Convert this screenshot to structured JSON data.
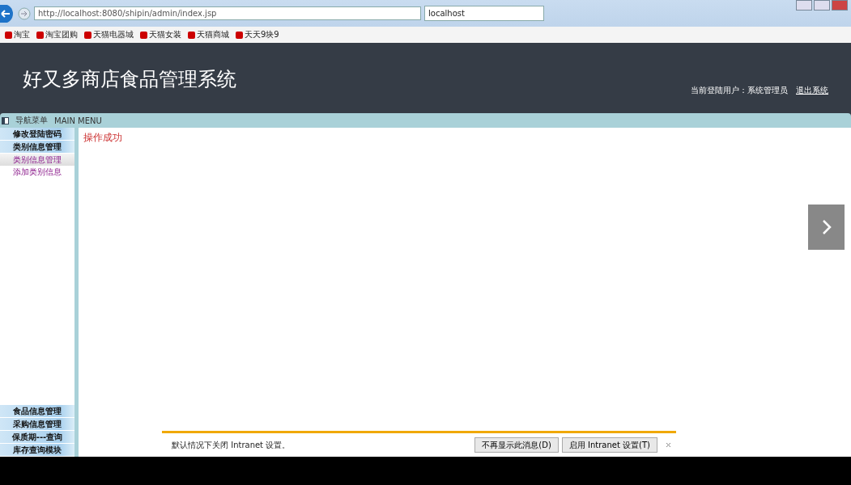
{
  "browser": {
    "address": "http://localhost:8080/shipin/admin/index.jsp",
    "tab": "localhost",
    "bookmarks": [
      "淘宝",
      "淘宝团购",
      "天猫电器城",
      "天猫女装",
      "天猫商城",
      "天天9块9"
    ]
  },
  "header": {
    "title": "好又多商店食品管理系统",
    "user_label": "当前登陆用户：系统管理员",
    "logout": "退出系统"
  },
  "menu": {
    "title": "导航菜单",
    "subtitle": "MAIN MENU",
    "top_items": [
      {
        "label": "修改登陆密码"
      },
      {
        "label": "类别信息管理",
        "children": [
          {
            "label": "类别信息管理",
            "selected": true
          },
          {
            "label": "添加类别信息",
            "selected": false
          }
        ]
      }
    ],
    "bottom_items": [
      {
        "label": "食品信息管理"
      },
      {
        "label": "采购信息管理"
      },
      {
        "label": "保质期---查询"
      },
      {
        "label": "库存查询模块"
      }
    ]
  },
  "content": {
    "message": "操作成功"
  },
  "notification": {
    "text": "默认情况下关闭 Intranet 设置。",
    "buttons": [
      "不再显示此消息(D)",
      "启用 Intranet 设置(T)"
    ]
  }
}
